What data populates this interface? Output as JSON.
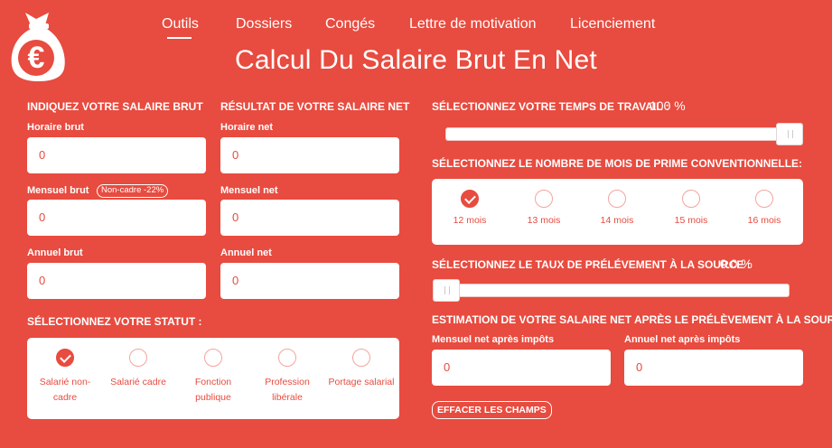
{
  "nav": {
    "items": [
      "Outils",
      "Dossiers",
      "Congés",
      "Lettre de motivation",
      "Licenciement"
    ],
    "active": "Outils"
  },
  "page_title": "Calcul Du Salaire Brut En Net",
  "logo": {
    "symbol": "€",
    "icon": "money-bag-euro-icon"
  },
  "brut": {
    "heading": "INDIQUEZ VOTRE SALAIRE BRUT",
    "horaire_label": "Horaire brut",
    "horaire_value": "0",
    "mensuel_label": "Mensuel brut",
    "mensuel_badge": "Non-cadre -22%",
    "mensuel_value": "0",
    "annuel_label": "Annuel brut",
    "annuel_value": "0"
  },
  "net": {
    "heading": "RÉSULTAT DE VOTRE SALAIRE NET",
    "horaire_label": "Horaire net",
    "horaire_value": "0",
    "mensuel_label": "Mensuel net",
    "mensuel_value": "0",
    "annuel_label": "Annuel net",
    "annuel_value": "0"
  },
  "statut": {
    "heading": "SÉLECTIONNEZ VOTRE STATUT :",
    "options": [
      {
        "label": "Salarié non-cadre",
        "checked": true
      },
      {
        "label": "Salarié cadre",
        "checked": false
      },
      {
        "label": "Fonction publique",
        "checked": false
      },
      {
        "label": "Profession libérale",
        "checked": false
      },
      {
        "label": "Portage salarial",
        "checked": false
      }
    ]
  },
  "temps": {
    "heading": "SÉLECTIONNEZ VOTRE TEMPS DE TRAVAIL :",
    "value": "100 %",
    "level": 1.0
  },
  "prime": {
    "heading": "SÉLECTIONNEZ LE NOMBRE DE MOIS DE PRIME CONVENTIONNELLE:",
    "options": [
      {
        "label": "12 mois",
        "checked": true
      },
      {
        "label": "13 mois",
        "checked": false
      },
      {
        "label": "14 mois",
        "checked": false
      },
      {
        "label": "15 mois",
        "checked": false
      },
      {
        "label": "16 mois",
        "checked": false
      }
    ]
  },
  "prelevement": {
    "heading": "SÉLECTIONNEZ LE TAUX DE PRÉLÉVEMENT À LA SOURCE :",
    "value": "0.0 %",
    "level": 0.0
  },
  "estimation": {
    "heading": "ESTIMATION DE VOTRE SALAIRE NET APRÈS LE PRÉLÈVEMENT À LA SOURCE",
    "mensuel_label": "Mensuel net après impôts",
    "mensuel_value": "0",
    "annuel_label": "Annuel net après impôts",
    "annuel_value": "0"
  },
  "clear_button": "EFFACER LES CHAMPS",
  "colors": {
    "background": "#e84b3f",
    "panel": "#ffffff",
    "accent": "#e84b3f"
  }
}
